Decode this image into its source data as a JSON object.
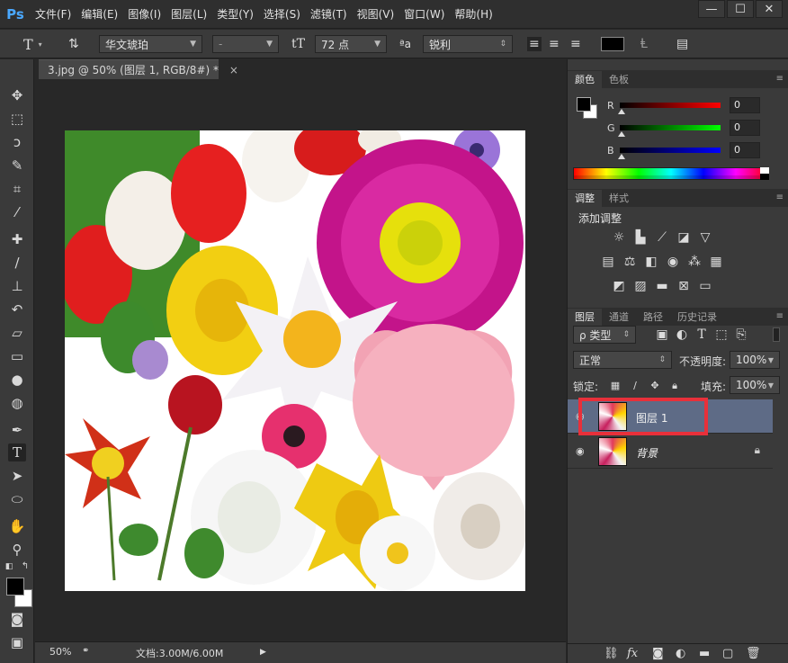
{
  "app": {
    "logo": "Ps"
  },
  "menu": [
    "文件(F)",
    "编辑(E)",
    "图像(I)",
    "图层(L)",
    "类型(Y)",
    "选择(S)",
    "滤镜(T)",
    "视图(V)",
    "窗口(W)",
    "帮助(H)"
  ],
  "window": {
    "minimize": "—",
    "maximize": "☐",
    "close": "✕"
  },
  "options": {
    "tool_icon": "type-tool-icon",
    "font_family": "华文琥珀",
    "font_style": "-",
    "font_size": "72 点",
    "aa_label": "ªa",
    "aa_mode": "锐利",
    "text_color": "#000000"
  },
  "document": {
    "tab_title": "3.jpg @ 50% (图层 1, RGB/8#) *",
    "close": "×"
  },
  "status": {
    "zoom": "50%",
    "doc_size": "文档:3.00M/6.00M"
  },
  "color_panel": {
    "tabs": [
      "颜色",
      "色板"
    ],
    "channels": [
      {
        "label": "R",
        "value": "0",
        "gradient": "#ff0000"
      },
      {
        "label": "G",
        "value": "0",
        "gradient": "#00ff00"
      },
      {
        "label": "B",
        "value": "0",
        "gradient": "#0000ff"
      }
    ]
  },
  "adjust_panel": {
    "tabs": [
      "调整",
      "样式"
    ],
    "title": "添加调整"
  },
  "layers_panel": {
    "tabs": [
      "图层",
      "通道",
      "路径",
      "历史记录"
    ],
    "filter_kind": "ρ 类型",
    "blend_mode": "正常",
    "opacity_label": "不透明度:",
    "opacity": "100%",
    "lock_label": "锁定:",
    "fill_label": "填充:",
    "fill": "100%",
    "layers": [
      {
        "name": "图层 1",
        "selected": true
      },
      {
        "name": "背景",
        "selected": false
      }
    ]
  }
}
